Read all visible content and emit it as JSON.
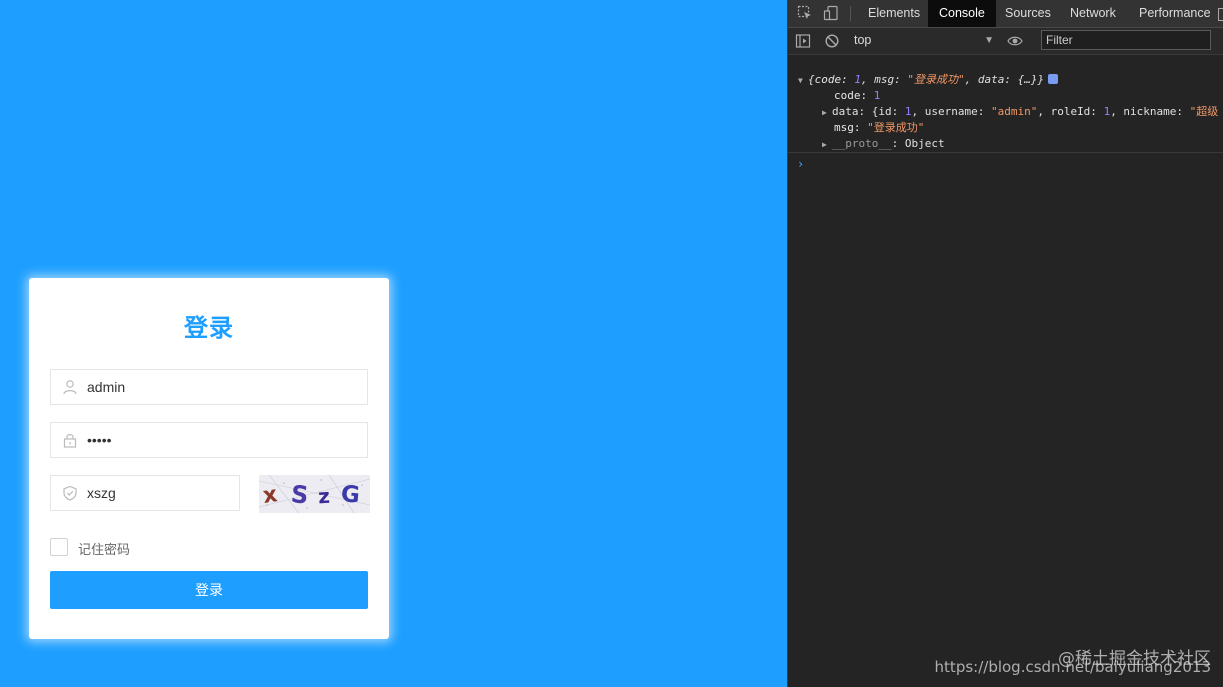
{
  "login": {
    "title": "登录",
    "username_value": "admin",
    "password_value": "•••••",
    "captcha_value": "xszg",
    "captcha_image_text": "xSzG",
    "remember_label": "记住密码",
    "submit_label": "登录"
  },
  "devtools": {
    "tabs": [
      {
        "label": "Elements",
        "active": false
      },
      {
        "label": "Console",
        "active": true
      },
      {
        "label": "Sources",
        "active": false
      },
      {
        "label": "Network",
        "active": false
      },
      {
        "label": "Performance",
        "active": false
      }
    ],
    "context": "top",
    "filter_placeholder": "Filter",
    "log": {
      "summary_open": "{",
      "summary_code_key": "code: ",
      "summary_code_val": "1",
      "summary_msg_key": ", msg: ",
      "summary_msg_val": "\"登录成功\"",
      "summary_data": ", data: {…}}",
      "code_key": "code: ",
      "code_val": "1",
      "data_prefix": "data: {id: ",
      "data_id": "1",
      "data_username_key": ", username: ",
      "data_username": "\"admin\"",
      "data_roleid_key": ", roleId: ",
      "data_roleid": "1",
      "data_nickname_key": ", nickname: ",
      "data_nickname": "\"超级",
      "msg_key": "msg: ",
      "msg_val": "\"登录成功\"",
      "proto_key": "__proto__",
      "proto_val": ": Object"
    }
  },
  "watermark": {
    "line1": "@稀土掘金技术社区",
    "line2": "https://blog.csdn.net/baiyuliang2013"
  },
  "colors": {
    "primary": "#1e9fff",
    "devtools_bg": "#242424"
  }
}
